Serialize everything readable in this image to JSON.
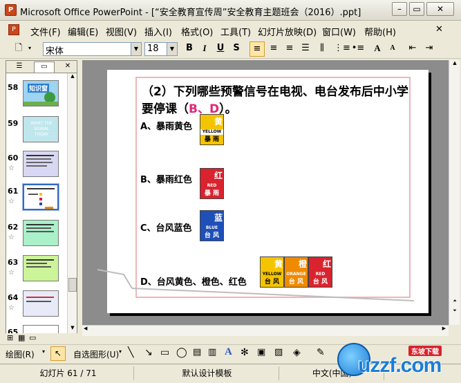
{
  "window": {
    "title": "Microsoft Office PowerPoint - [“安全教育宣传周”安全教育主题班会（2016）.ppt]"
  },
  "menu": [
    "文件(F)",
    "编辑(E)",
    "视图(V)",
    "插入(I)",
    "格式(O)",
    "工具(T)",
    "幻灯片放映(D)",
    "窗口(W)",
    "帮助(H)"
  ],
  "toolbar": {
    "font": "宋体",
    "size": "18",
    "bold": "B",
    "italic": "I",
    "underline": "U",
    "shadow": "S",
    "grow": "A",
    "shrink": "A"
  },
  "thumbnails": [
    {
      "num": "58",
      "star": ""
    },
    {
      "num": "59",
      "star": ""
    },
    {
      "num": "60",
      "star": "☆"
    },
    {
      "num": "61",
      "star": "☆"
    },
    {
      "num": "62",
      "star": "☆"
    },
    {
      "num": "63",
      "star": "☆"
    },
    {
      "num": "64",
      "star": "☆"
    },
    {
      "num": "65",
      "star": ""
    }
  ],
  "thumb_texts": {
    "t58": "知识窗",
    "t59": "WHAT THE SIGNAL TODAY"
  },
  "slide": {
    "question": "（2）下列哪些预警信号在电视、电台发布后中小学要停课（",
    "answer": "B、D",
    "question_end": "）。",
    "options": [
      "A、暴雨黄色",
      "B、暴雨红色",
      "C、台风蓝色",
      "D、台风黄色、橙色、红色"
    ],
    "signals": {
      "a": {
        "ch": "黄",
        "en": "YELLOW",
        "cn": "暴 雨",
        "color": "#f5c400"
      },
      "b": {
        "ch": "红",
        "en": "RED",
        "cn": "暴 雨",
        "color": "#d9232e"
      },
      "c": {
        "ch": "蓝",
        "en": "BLUE",
        "cn": "台 风",
        "color": "#1f4fb8"
      },
      "d1": {
        "ch": "黄",
        "en": "YELLOW",
        "cn": "台 风",
        "color": "#f5c400"
      },
      "d2": {
        "ch": "橙",
        "en": "ORANGE",
        "cn": "台 风",
        "color": "#f08a00"
      },
      "d3": {
        "ch": "红",
        "en": "RED",
        "cn": "台 风",
        "color": "#d9232e"
      }
    }
  },
  "drawbar": {
    "draw": "绘图(R)",
    "autoshapes": "自选图形(U)"
  },
  "status": {
    "slide": "幻灯片 61 / 71",
    "design": "默认设计模板",
    "lang": "中文(中国)"
  },
  "logo": {
    "text": "uzzf.com",
    "tag": "东坡下载"
  }
}
